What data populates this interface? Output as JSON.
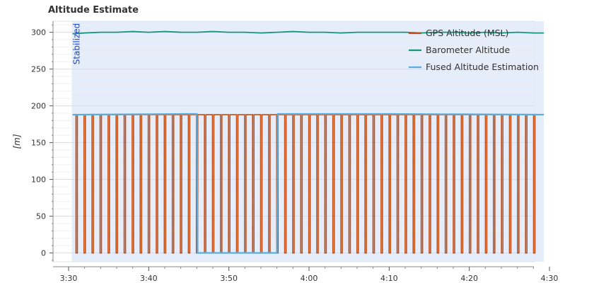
{
  "chart_data": {
    "type": "line",
    "title": "Altitude Estimate",
    "ylabel": "[m]",
    "xlabel": "",
    "xlim_min": [
      210,
      270
    ],
    "ylim": [
      -12,
      315
    ],
    "x_ticks": [
      {
        "value": 210,
        "label": "3:30"
      },
      {
        "value": 220,
        "label": "3:40"
      },
      {
        "value": 230,
        "label": "3:50"
      },
      {
        "value": 240,
        "label": "4:00"
      },
      {
        "value": 250,
        "label": "4:10"
      },
      {
        "value": 260,
        "label": "4:20"
      },
      {
        "value": 270,
        "label": "4:30"
      }
    ],
    "y_ticks": [
      0,
      50,
      100,
      150,
      200,
      250,
      300
    ],
    "grid": true,
    "legend_position": "top-right",
    "shaded_region": {
      "x_start_min": 210.4,
      "x_end_min": 269.3,
      "label": "Stabilized"
    },
    "series": [
      {
        "name": "GPS Altitude (MSL)",
        "color": "#c0501a",
        "pattern": "square-pulse",
        "high": 188,
        "low": 0,
        "x_start_min": 210.8,
        "x_end_min": 268.9,
        "pulses": 58
      },
      {
        "name": "Barometer Altitude",
        "color": "#17967a",
        "x_min": [
          210.5,
          212,
          214,
          216,
          218,
          220,
          222,
          224,
          226,
          228,
          230,
          232,
          234,
          236,
          238,
          240,
          242,
          244,
          246,
          248,
          250,
          252,
          254,
          256,
          258,
          260,
          262,
          264,
          266,
          268,
          269.3
        ],
        "values": [
          298,
          299,
          300,
          300,
          301,
          300,
          301,
          300,
          300,
          301,
          300,
          300,
          299,
          300,
          301,
          300,
          300,
          299,
          300,
          300,
          300,
          300,
          299,
          300,
          300,
          299,
          300,
          299,
          300,
          299,
          299
        ]
      },
      {
        "name": "Fused Altitude Estimation",
        "color": "#5aaee0",
        "x_min": [
          210.5,
          224.4,
          226,
          226.1,
          236,
          236.1,
          250,
          269.3
        ],
        "values": [
          188,
          189,
          189,
          0,
          0,
          189,
          189,
          188
        ]
      }
    ]
  }
}
